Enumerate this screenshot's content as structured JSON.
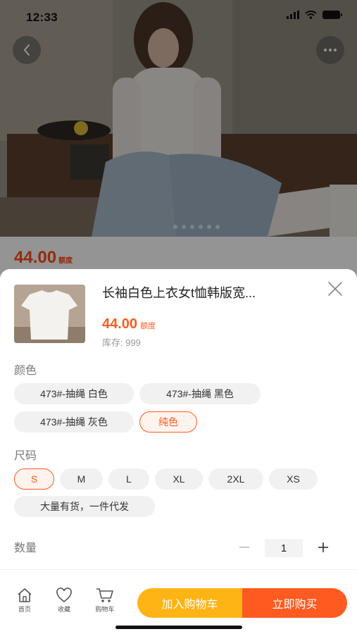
{
  "status": {
    "time": "12:33"
  },
  "background": {
    "price": "44.00",
    "price_unit": "额度"
  },
  "sheet": {
    "product_title": "长袖白色上衣女t恤韩版宽...",
    "price": "44.00",
    "price_unit": "额度",
    "stock": "库存: 999",
    "color_label": "颜色",
    "colors": [
      {
        "label": "473#-抽绳 白色",
        "selected": false
      },
      {
        "label": "473#-抽绳 黑色",
        "selected": false
      },
      {
        "label": "473#-抽绳 灰色",
        "selected": false
      },
      {
        "label": "纯色",
        "selected": true
      }
    ],
    "size_label": "尺码",
    "sizes": [
      {
        "label": "S",
        "selected": true
      },
      {
        "label": "M",
        "selected": false
      },
      {
        "label": "L",
        "selected": false
      },
      {
        "label": "XL",
        "selected": false
      },
      {
        "label": "2XL",
        "selected": false
      },
      {
        "label": "XS",
        "selected": false
      },
      {
        "label": "大量有货，一件代发",
        "selected": false
      }
    ],
    "quantity_label": "数量",
    "quantity": "1"
  },
  "bottom_bar": {
    "tabs": [
      {
        "label": "首页",
        "icon": "home-icon"
      },
      {
        "label": "收藏",
        "icon": "heart-icon"
      },
      {
        "label": "购物车",
        "icon": "cart-icon"
      }
    ],
    "add_to_cart": "加入购物车",
    "buy_now": "立即购买"
  },
  "colors": {
    "accent": "#ff5a1f",
    "cart_button": "#ffb415"
  }
}
